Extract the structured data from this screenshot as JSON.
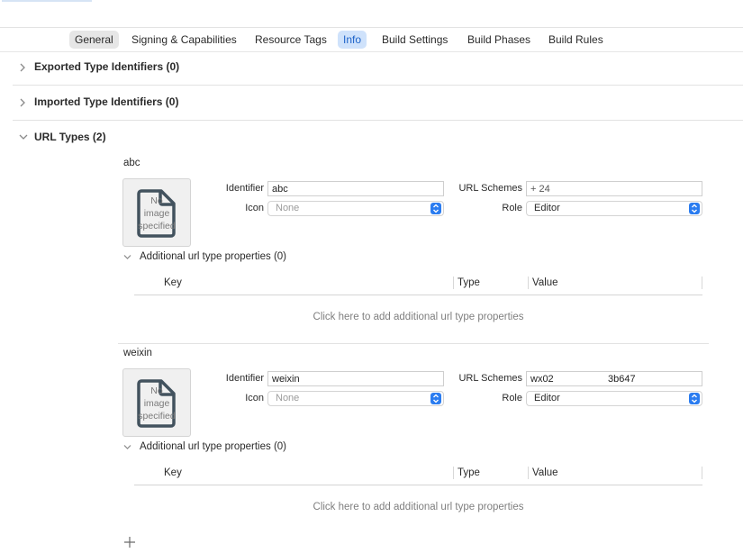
{
  "tabs": [
    "General",
    "Signing & Capabilities",
    "Resource Tags",
    "Info",
    "Build Settings",
    "Build Phases",
    "Build Rules"
  ],
  "sections": {
    "exported": "Exported Type Identifiers (0)",
    "imported": "Imported Type Identifiers (0)",
    "url_types": "URL Types (2)"
  },
  "url_types": [
    {
      "name": "abc",
      "no_image": [
        "No",
        "image",
        "specified"
      ],
      "identifier_label": "Identifier",
      "identifier": "abc",
      "icon_label": "Icon",
      "icon_value": "None",
      "schemes_label": "URL Schemes",
      "schemes_visible": "+ 24",
      "role_label": "Role",
      "role": "Editor",
      "additional": "Additional url type properties (0)",
      "col_key": "Key",
      "col_type": "Type",
      "col_value": "Value",
      "placeholder": "Click here to add additional url type properties"
    },
    {
      "name": "weixin",
      "no_image": [
        "No",
        "image",
        "specified"
      ],
      "identifier_label": "Identifier",
      "identifier": "weixin",
      "icon_label": "Icon",
      "icon_value": "None",
      "schemes_label": "URL Schemes",
      "schemes_visible_a": "wx02",
      "schemes_visible_b": "3b647",
      "role_label": "Role",
      "role": "Editor",
      "additional": "Additional url type properties (0)",
      "col_key": "Key",
      "col_type": "Type",
      "col_value": "Value",
      "placeholder": "Click here to add additional url type properties"
    }
  ],
  "add_button": "+",
  "colors": {
    "accent": "#2a7cf0",
    "active_tab_bg": "#cfe2fb",
    "active_tab_text": "#1d63c9"
  },
  "icons": [
    "chevron-right-icon",
    "chevron-down-icon",
    "document-icon",
    "popup-stepper-icon",
    "plus-icon"
  ]
}
